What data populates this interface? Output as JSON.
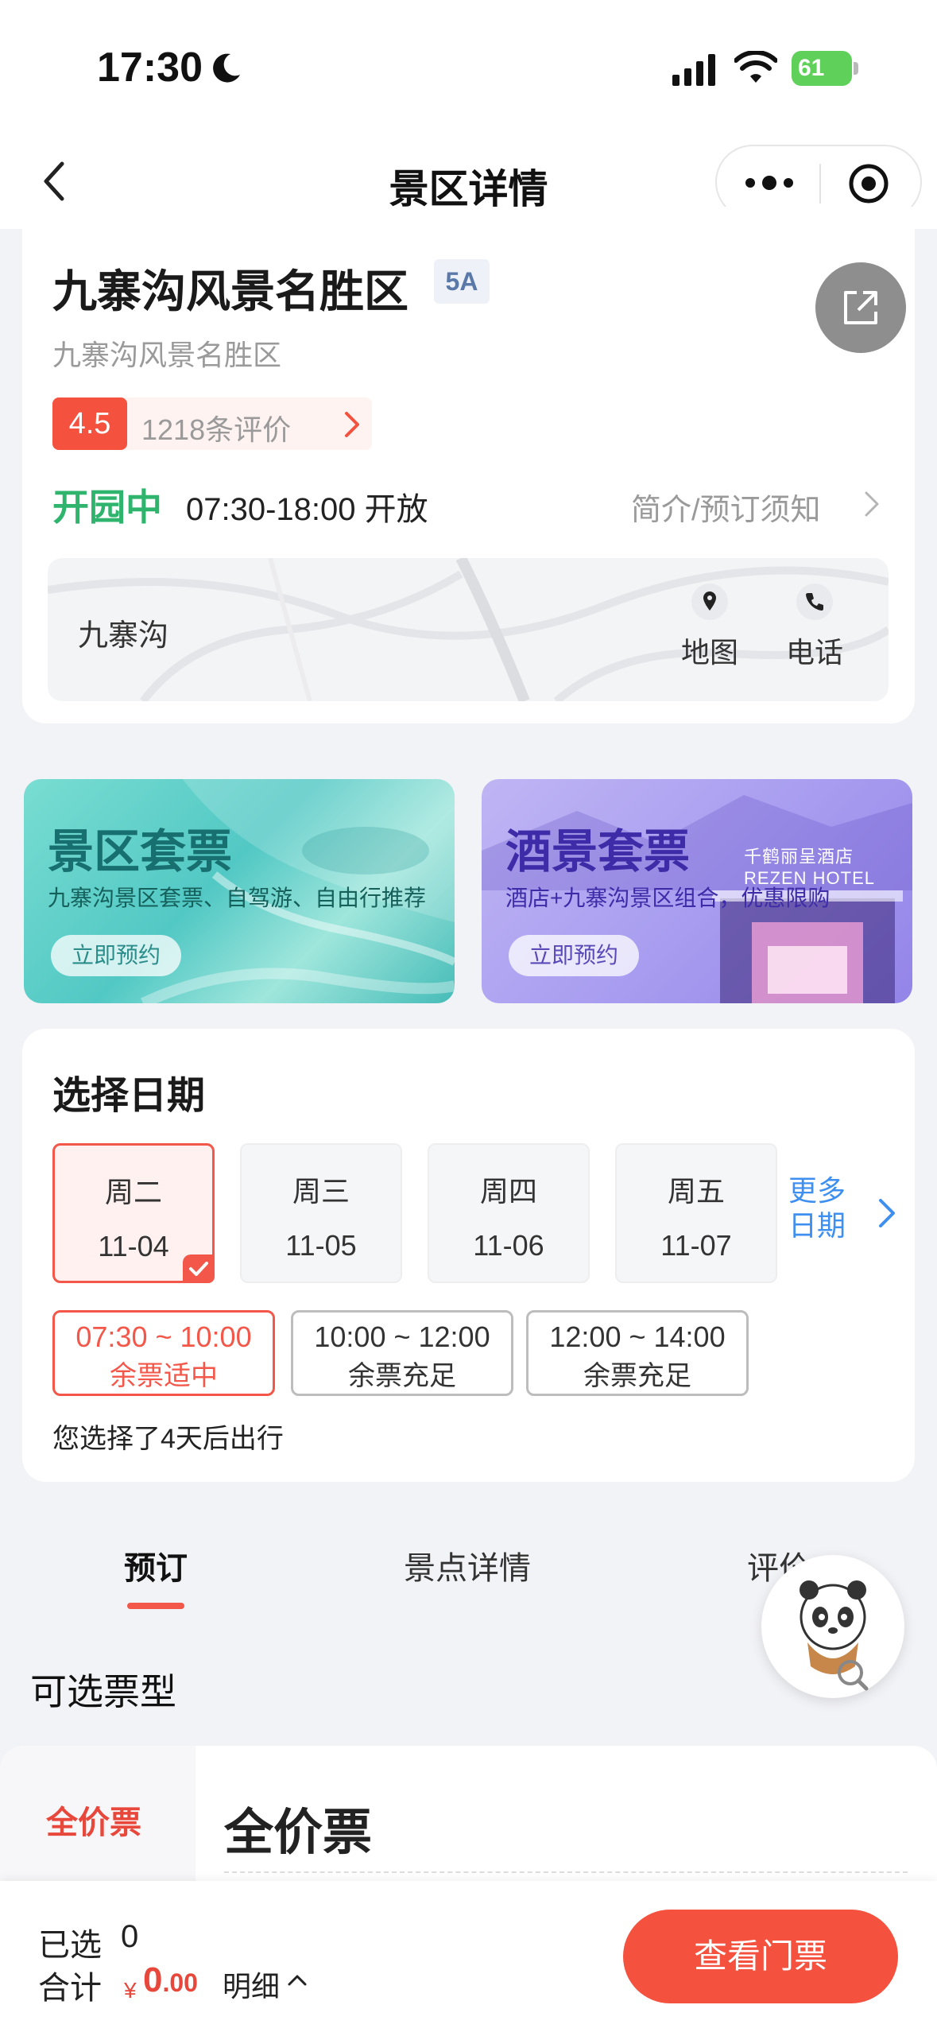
{
  "status_bar": {
    "time": "17:30",
    "battery": "61"
  },
  "nav": {
    "title": "景区详情"
  },
  "scenic": {
    "name": "九寨沟风景名胜区",
    "grade": "5A",
    "sub_name": "九寨沟风景名胜区",
    "rating": "4.5",
    "review_count": "1218条评价",
    "open_status": "开园中",
    "open_hours": "07:30-18:00 开放",
    "notice_link": "简介/预订须知",
    "location": "九寨沟",
    "map_label": "地图",
    "phone_label": "电话"
  },
  "promos": [
    {
      "title": "景区套票",
      "desc": "九寨沟景区套票、自驾游、自由行推荐",
      "button": "立即预约"
    },
    {
      "title": "酒景套票",
      "desc": "酒店+九寨沟景区组合，优惠限购",
      "button": "立即预约",
      "hotel_logo": "千鹤丽呈酒店 REZEN HOTEL"
    }
  ],
  "date_picker": {
    "title": "选择日期",
    "dates": [
      {
        "weekday": "周二",
        "date": "11-04",
        "selected": true
      },
      {
        "weekday": "周三",
        "date": "11-05",
        "selected": false
      },
      {
        "weekday": "周四",
        "date": "11-06",
        "selected": false
      },
      {
        "weekday": "周五",
        "date": "11-07",
        "selected": false
      }
    ],
    "more_dates": "更多日期",
    "slots": [
      {
        "time": "07:30 ~ 10:00",
        "status": "余票适中",
        "selected": true
      },
      {
        "time": "10:00 ~ 12:00",
        "status": "余票充足",
        "selected": false
      },
      {
        "time": "12:00 ~ 14:00",
        "status": "余票充足",
        "selected": false
      }
    ],
    "hint": "您选择了4天后出行"
  },
  "tabs": [
    {
      "label": "预订",
      "active": true
    },
    {
      "label": "景点详情",
      "active": false
    },
    {
      "label": "评价",
      "active": false
    }
  ],
  "ticket_types": {
    "label": "可选票型",
    "side_category": "全价票",
    "heading": "全价票"
  },
  "bottom_bar": {
    "selected_label": "已选",
    "selected_count": "0",
    "total_label": "合计",
    "currency": "¥",
    "amount_int": "0",
    "amount_dec": ".00",
    "detail": "明细",
    "checkout": "查看门票"
  },
  "colors": {
    "accent": "#f4513f",
    "open_green": "#2fb46d",
    "link_blue": "#3e8ff0"
  }
}
